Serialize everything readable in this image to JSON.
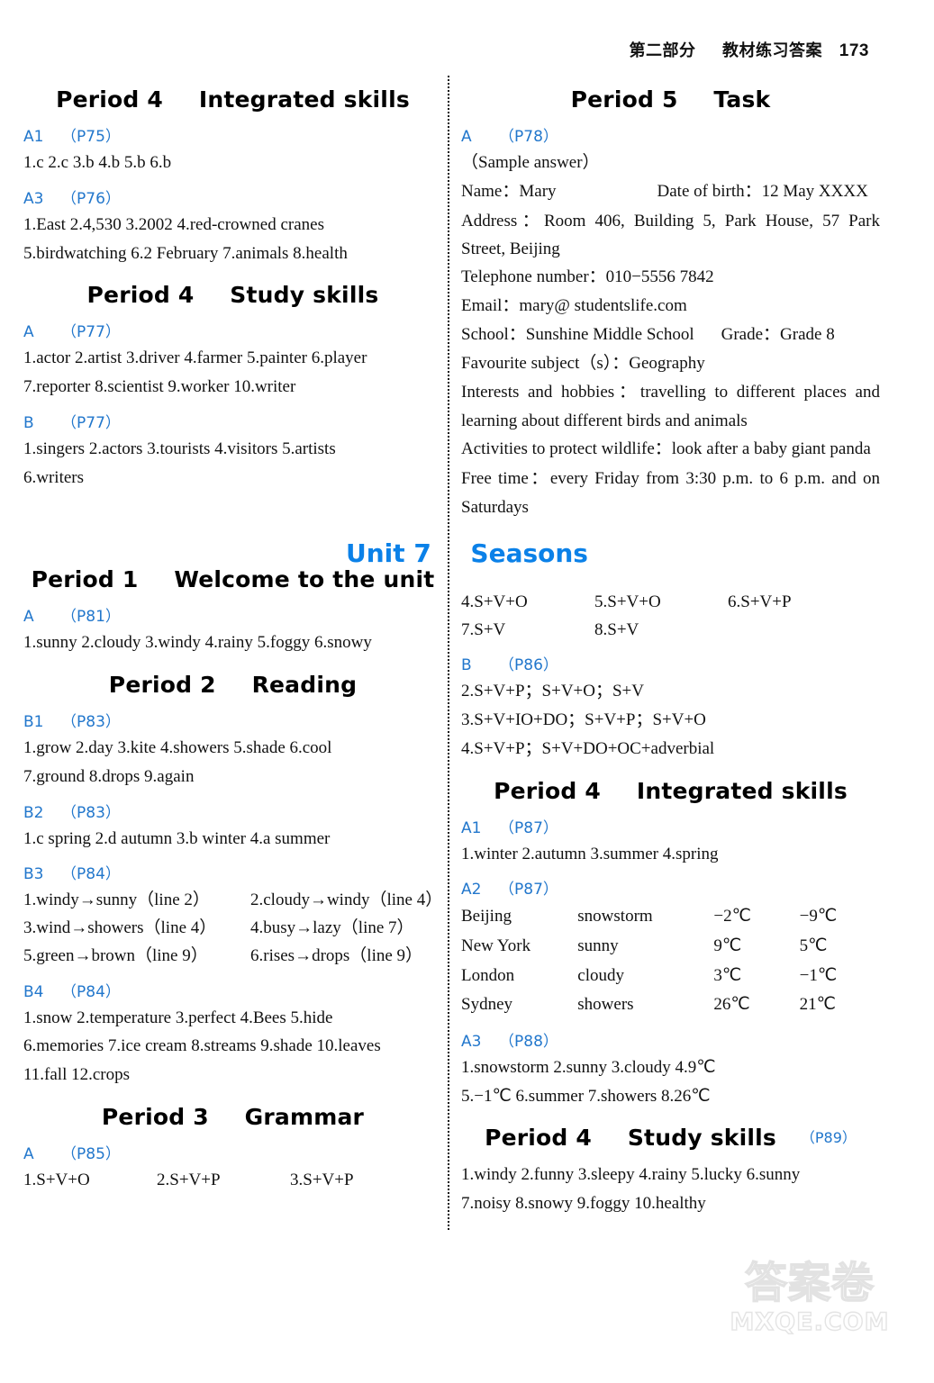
{
  "header": {
    "section_cn": "第二部分",
    "title_cn": "教材练习答案",
    "page_number": "173"
  },
  "unit_heading": {
    "unit": "Unit 7",
    "name": "Seasons"
  },
  "left_column": {
    "period4_integrated": {
      "period": "Period 4",
      "name": "Integrated skills",
      "blocks": [
        {
          "id": "A1",
          "page": "（P75）",
          "lines": [
            "1.c  2.c  3.b  4.b  5.b  6.b"
          ]
        },
        {
          "id": "A3",
          "page": "（P76）",
          "lines": [
            "1.East   2.4,530   3.2002   4.red-crowned cranes",
            "5.birdwatching   6.2 February   7.animals   8.health"
          ]
        }
      ]
    },
    "period4_study": {
      "period": "Period 4",
      "name": "Study skills",
      "blocks": [
        {
          "id": "A",
          "page": "（P77）",
          "lines": [
            "1.actor  2.artist  3.driver  4.farmer  5.painter  6.player",
            "7.reporter  8.scientist  9.worker  10.writer"
          ]
        },
        {
          "id": "B",
          "page": "（P77）",
          "lines": [
            "1.singers  2.actors  3.tourists  4.visitors  5.artists",
            "6.writers"
          ]
        }
      ]
    },
    "period1_welcome": {
      "period": "Period 1",
      "name": "Welcome to the unit",
      "blocks": [
        {
          "id": "A",
          "page": "（P81）",
          "lines": [
            "1.sunny  2.cloudy  3.windy  4.rainy  5.foggy  6.snowy"
          ]
        }
      ]
    },
    "period2_reading": {
      "period": "Period 2",
      "name": "Reading",
      "b1": {
        "id": "B1",
        "page": "（P83）",
        "lines": [
          "1.grow  2.day  3.kite  4.showers  5.shade  6.cool",
          "7.ground  8.drops  9.again"
        ]
      },
      "b2": {
        "id": "B2",
        "page": "（P83）",
        "lines": [
          "1.c spring  2.d autumn  3.b winter  4.a summer"
        ]
      },
      "b3": {
        "id": "B3",
        "page": "（P84）",
        "pairs": [
          [
            "1.windy→sunny（line 2）",
            "2.cloudy→windy（line 4）"
          ],
          [
            "3.wind→showers（line 4）",
            "4.busy→lazy（line 7）"
          ],
          [
            "5.green→brown（line 9）",
            "6.rises→drops（line 9）"
          ]
        ]
      },
      "b4": {
        "id": "B4",
        "page": "（P84）",
        "lines": [
          "1.snow  2.temperature  3.perfect  4.Bees  5.hide",
          "6.memories  7.ice cream  8.streams  9.shade  10.leaves",
          "11.fall  12.crops"
        ]
      }
    },
    "period3_grammar": {
      "period": "Period 3",
      "name": "Grammar",
      "block": {
        "id": "A",
        "page": "（P85）",
        "row": [
          "1.S+V+O",
          "2.S+V+P",
          "3.S+V+P"
        ]
      }
    }
  },
  "right_column": {
    "period5_task": {
      "period": "Period 5",
      "name": "Task",
      "block": {
        "id": "A",
        "page": "（P78）",
        "sample_note": "（Sample answer）",
        "fields": [
          {
            "label": "Name：Mary",
            "label2": "Date of birth：12 May XXXX"
          },
          {
            "text": "Address：Room 406, Building 5, Park House, 57 Park Street, Beijing"
          },
          {
            "text": "Telephone number：010−5556 7842"
          },
          {
            "text": "Email：mary@ studentslife.com"
          },
          {
            "label": "School：Sunshine Middle School",
            "label2": "Grade：Grade 8"
          },
          {
            "text": "Favourite subject（s）：Geography"
          },
          {
            "text": "Interests and hobbies：travelling to different places and learning about different birds and animals"
          },
          {
            "text": "Activities to protect wildlife：look after a baby giant panda"
          },
          {
            "text": "Free time：every Friday from 3:30 p.m. to 6 p.m. and on Saturdays"
          }
        ]
      }
    },
    "grammar_continued": {
      "rows": [
        [
          "4.S+V+O",
          "5.S+V+O",
          "6.S+V+P"
        ],
        [
          "7.S+V",
          "8.S+V",
          ""
        ]
      ],
      "block_b": {
        "id": "B",
        "page": "（P86）",
        "lines": [
          "2.S+V+P；S+V+O；S+V",
          "3.S+V+IO+DO；S+V+P；S+V+O",
          "4.S+V+P；S+V+DO+OC+adverbial"
        ]
      }
    },
    "period4_integrated": {
      "period": "Period 4",
      "name": "Integrated skills",
      "a1": {
        "id": "A1",
        "page": "（P87）",
        "lines": [
          "1.winter   2.autumn   3.summer   4.spring"
        ]
      },
      "a2": {
        "id": "A2",
        "page": "（P87）",
        "rows": [
          {
            "city": "Beijing",
            "condition": "snowstorm",
            "high": "−2℃",
            "low": "−9℃"
          },
          {
            "city": "New York",
            "condition": "sunny",
            "high": "9℃",
            "low": "5℃"
          },
          {
            "city": "London",
            "condition": "cloudy",
            "high": "3℃",
            "low": "−1℃"
          },
          {
            "city": "Sydney",
            "condition": "showers",
            "high": "26℃",
            "low": "21℃"
          }
        ]
      },
      "a3": {
        "id": "A3",
        "page": "（P88）",
        "lines": [
          "1.snowstorm   2.sunny   3.cloudy   4.9℃",
          "5.−1℃   6.summer   7.showers   8.26℃"
        ]
      }
    },
    "period4_study": {
      "period": "Period 4",
      "name": "Study skills",
      "page": "（P89）",
      "lines": [
        "1.windy   2.funny   3.sleepy   4.rainy   5.lucky   6.sunny",
        "7.noisy   8.snowy   9.foggy   10.healthy"
      ]
    }
  },
  "watermark": {
    "cn": "答案卷",
    "en": "MXQE.COM"
  }
}
